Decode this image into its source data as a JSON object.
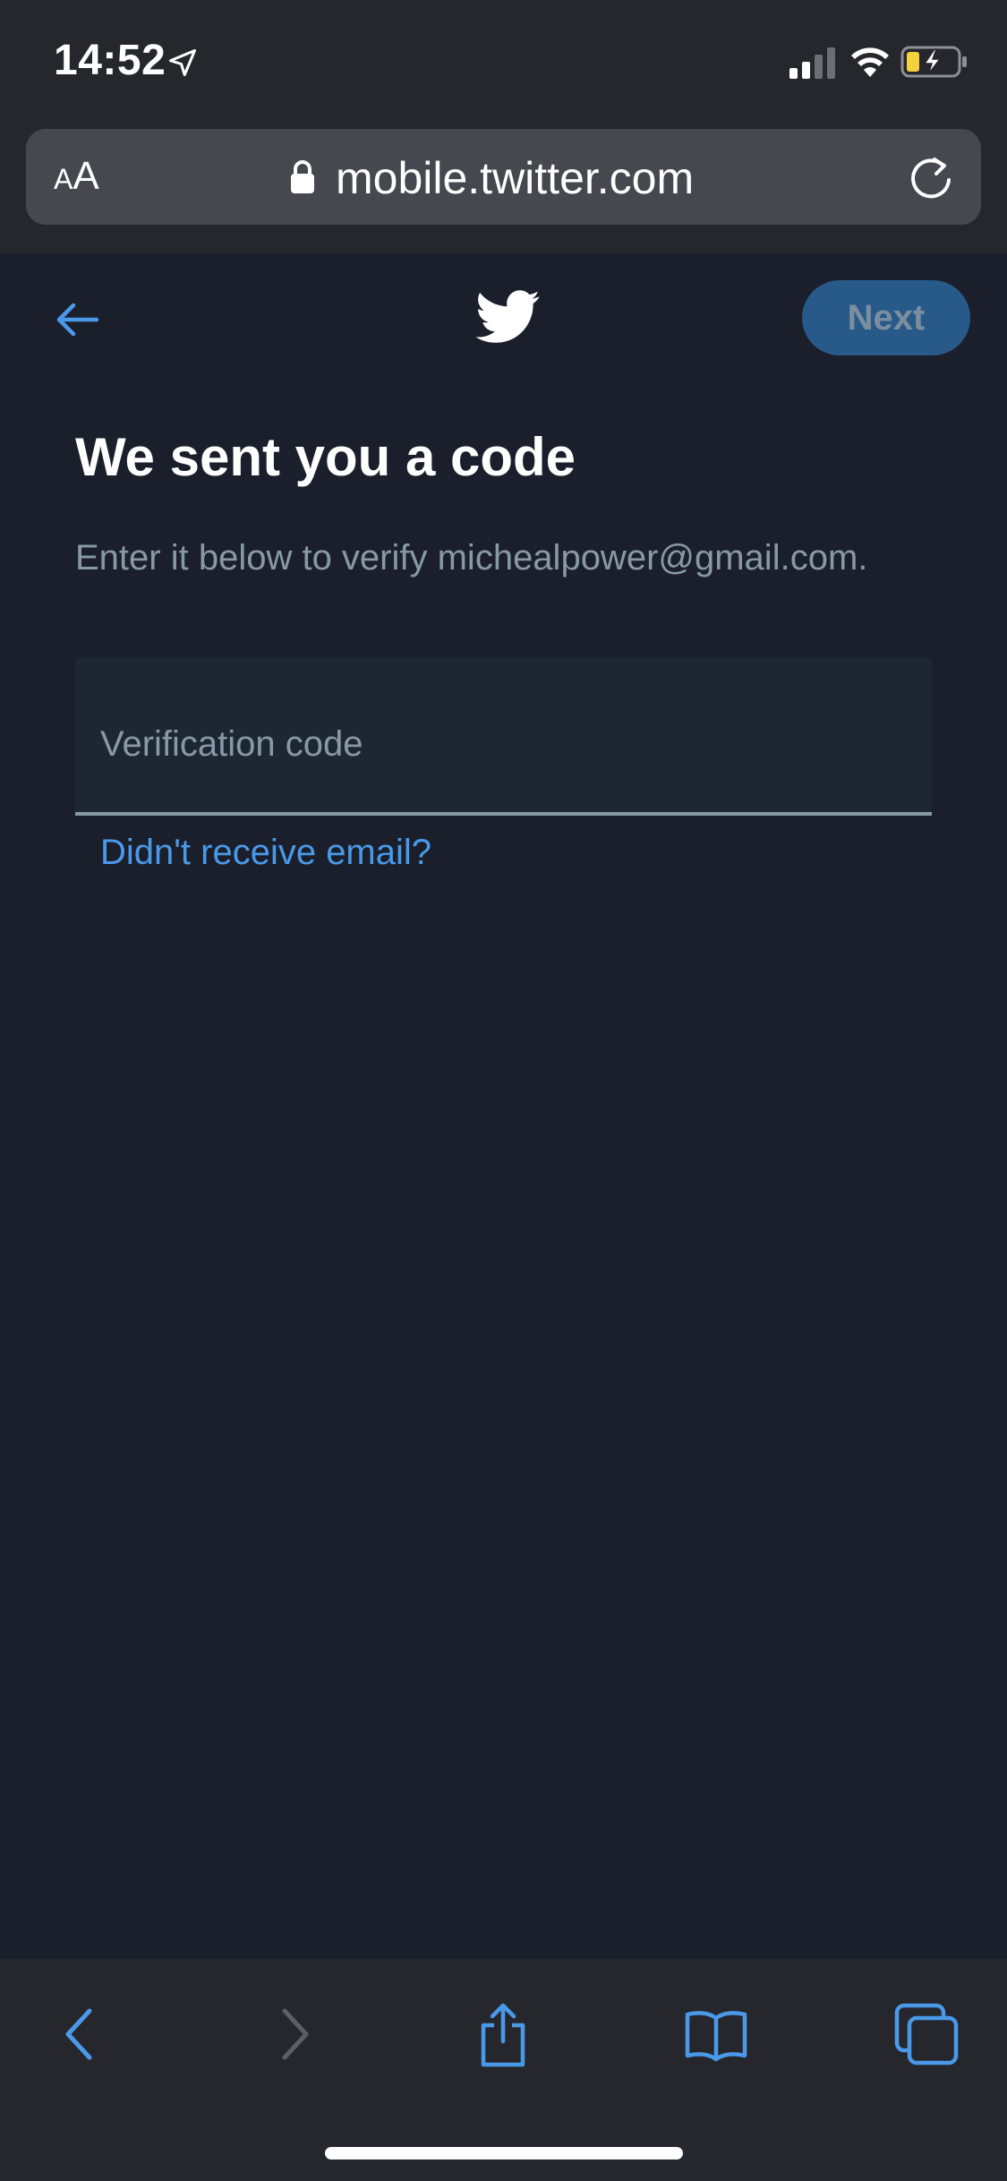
{
  "status_bar": {
    "time": "14:52"
  },
  "browser": {
    "text_size_label_small": "A",
    "text_size_label_large": "A",
    "url": "mobile.twitter.com"
  },
  "header": {
    "next_label": "Next"
  },
  "content": {
    "heading": "We sent you a code",
    "subtext": "Enter it below to verify michealpower@gmail.com.",
    "code_placeholder": "Verification code",
    "resend_link": "Didn't receive email?"
  },
  "colors": {
    "accent": "#4a99e9",
    "background": "#1a1f2b",
    "next_button_bg": "#275a89",
    "muted_text": "#8899a6"
  },
  "icons": {
    "status": [
      "location-arrow-icon",
      "signal-icon",
      "wifi-icon",
      "battery-charging-icon"
    ],
    "browser": [
      "lock-icon",
      "reload-icon"
    ],
    "header": [
      "back-arrow-icon",
      "twitter-bird-icon"
    ],
    "toolbar": [
      "back-chevron-icon",
      "forward-chevron-icon",
      "share-icon",
      "bookmarks-icon",
      "tabs-icon"
    ]
  }
}
